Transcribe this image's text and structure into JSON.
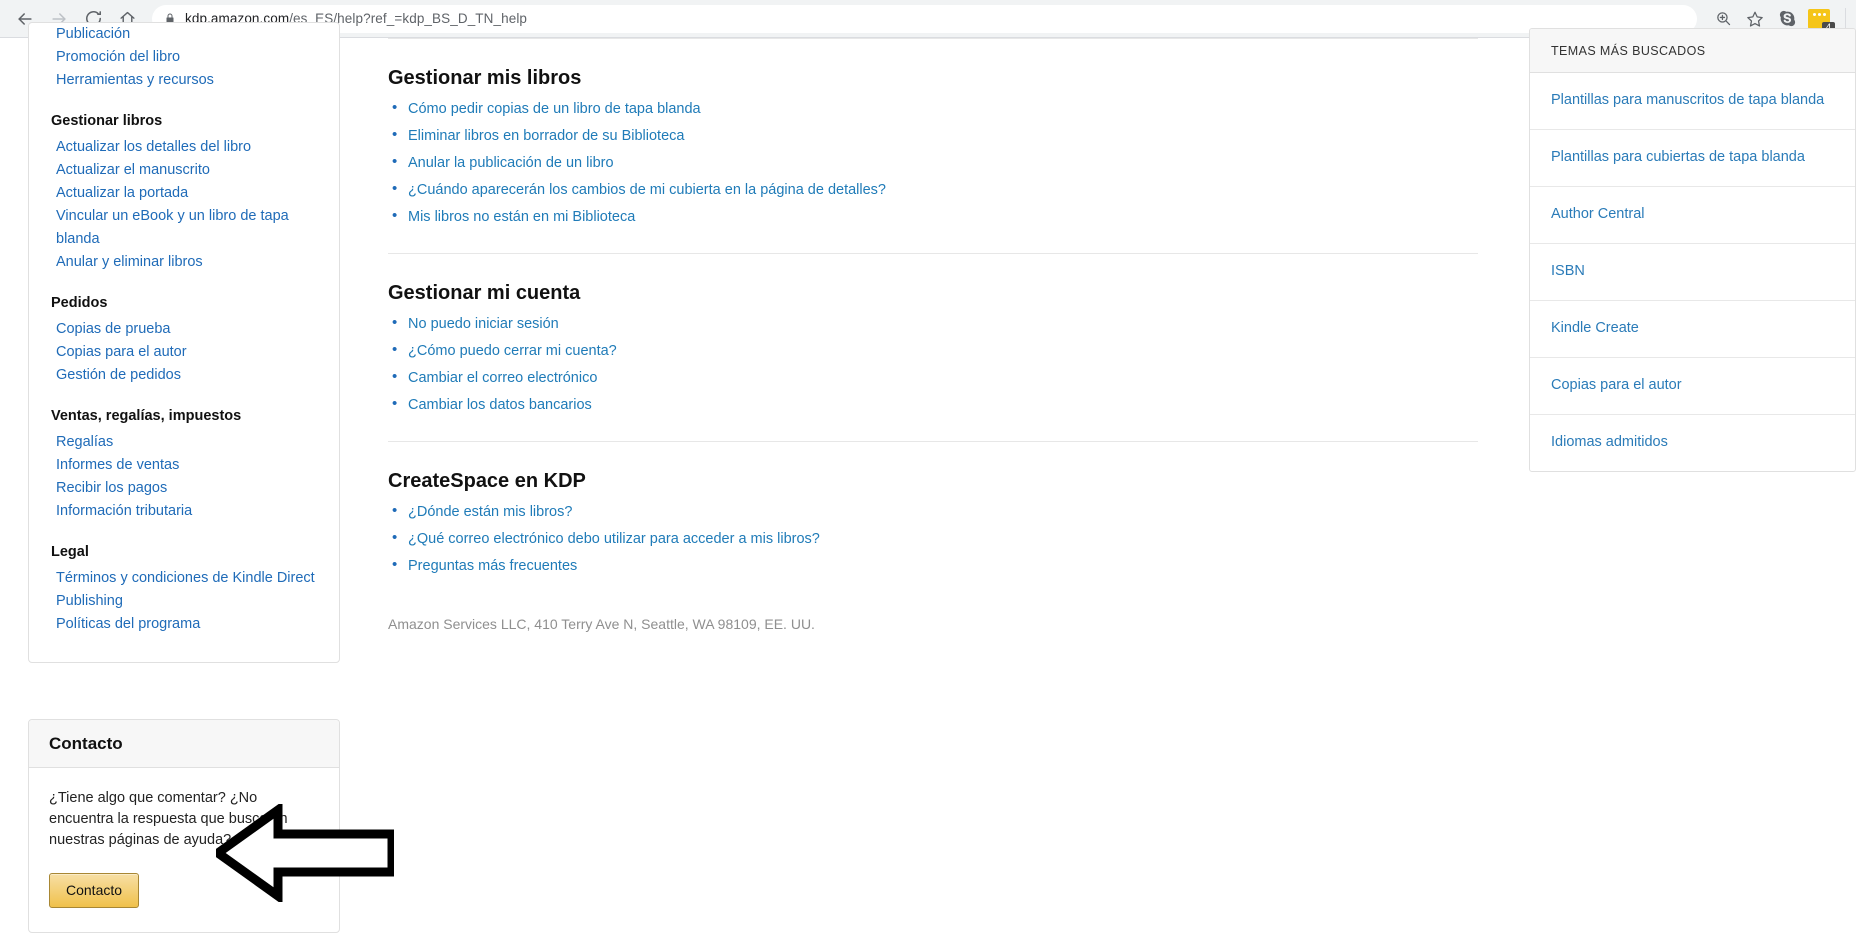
{
  "browser": {
    "url_host": "kdp.amazon.com",
    "url_path": "/es_ES/help?ref_=kdp_BS_D_TN_help",
    "back_icon": "back-arrow-icon",
    "forward_icon": "forward-arrow-icon",
    "reload_icon": "reload-icon",
    "home_icon": "home-icon",
    "lock_icon": "lock-icon",
    "zoom_icon": "zoom-in-icon",
    "bookmark_icon": "star-icon",
    "skype_icon": "skype-extension-icon",
    "extension_icon": "yellow-extension-icon",
    "extension_badge": "4"
  },
  "sidebar": {
    "groups": [
      {
        "heading": "",
        "links": [
          "Publicación",
          "Promoción del libro",
          "Herramientas y recursos"
        ]
      },
      {
        "heading": "Gestionar libros",
        "links": [
          "Actualizar los detalles del libro",
          "Actualizar el manuscrito",
          "Actualizar la portada",
          "Vincular un eBook y un libro de tapa blanda",
          "Anular y eliminar libros"
        ]
      },
      {
        "heading": "Pedidos",
        "links": [
          "Copias de prueba",
          "Copias para el autor",
          "Gestión de pedidos"
        ]
      },
      {
        "heading": "Ventas, regalías, impuestos",
        "links": [
          "Regalías",
          "Informes de ventas",
          "Recibir los pagos",
          "Información tributaria"
        ]
      },
      {
        "heading": "Legal",
        "links": [
          "Términos y condiciones de Kindle Direct Publishing",
          "Políticas del programa"
        ]
      }
    ]
  },
  "contact": {
    "title": "Contacto",
    "text": "¿Tiene algo que comentar? ¿No encuentra la respuesta que busca en nuestras páginas de ayuda?",
    "button_label": "Contacto",
    "button_color": "#f0c14b",
    "button_border": "#a88734"
  },
  "main": {
    "sections": [
      {
        "title": "Gestionar mis libros",
        "items": [
          "Cómo pedir copias de un libro de tapa blanda",
          "Eliminar libros en borrador de su Biblioteca",
          "Anular la publicación de un libro",
          "¿Cuándo aparecerán los cambios de mi cubierta en la página de detalles?",
          "Mis libros no están en mi Biblioteca"
        ]
      },
      {
        "title": "Gestionar mi cuenta",
        "items": [
          "No puedo iniciar sesión",
          "¿Cómo puedo cerrar mi cuenta?",
          "Cambiar el correo electrónico",
          "Cambiar los datos bancarios"
        ]
      },
      {
        "title": "CreateSpace en KDP",
        "items": [
          "¿Dónde están mis libros?",
          "¿Qué correo electrónico debo utilizar para acceder a mis libros?",
          "Preguntas más frecuentes"
        ]
      }
    ],
    "footer_address": "Amazon Services LLC, 410 Terry Ave N, Seattle, WA 98109, EE. UU."
  },
  "topics": {
    "title": "TEMAS MÁS BUSCADOS",
    "items": [
      "Plantillas para manuscritos de tapa blanda",
      "Plantillas para cubiertas de tapa blanda",
      "Author Central",
      "ISBN",
      "Kindle Create",
      "Copias para el autor",
      "Idiomas admitidos"
    ]
  },
  "annotation": {
    "shape": "left-pointing-arrow",
    "color": "#000000"
  },
  "colors": {
    "link": "#1f6bb8",
    "heading": "#111111",
    "chrome_bg": "#f1f3f4",
    "card_border": "#e0e0e0"
  }
}
